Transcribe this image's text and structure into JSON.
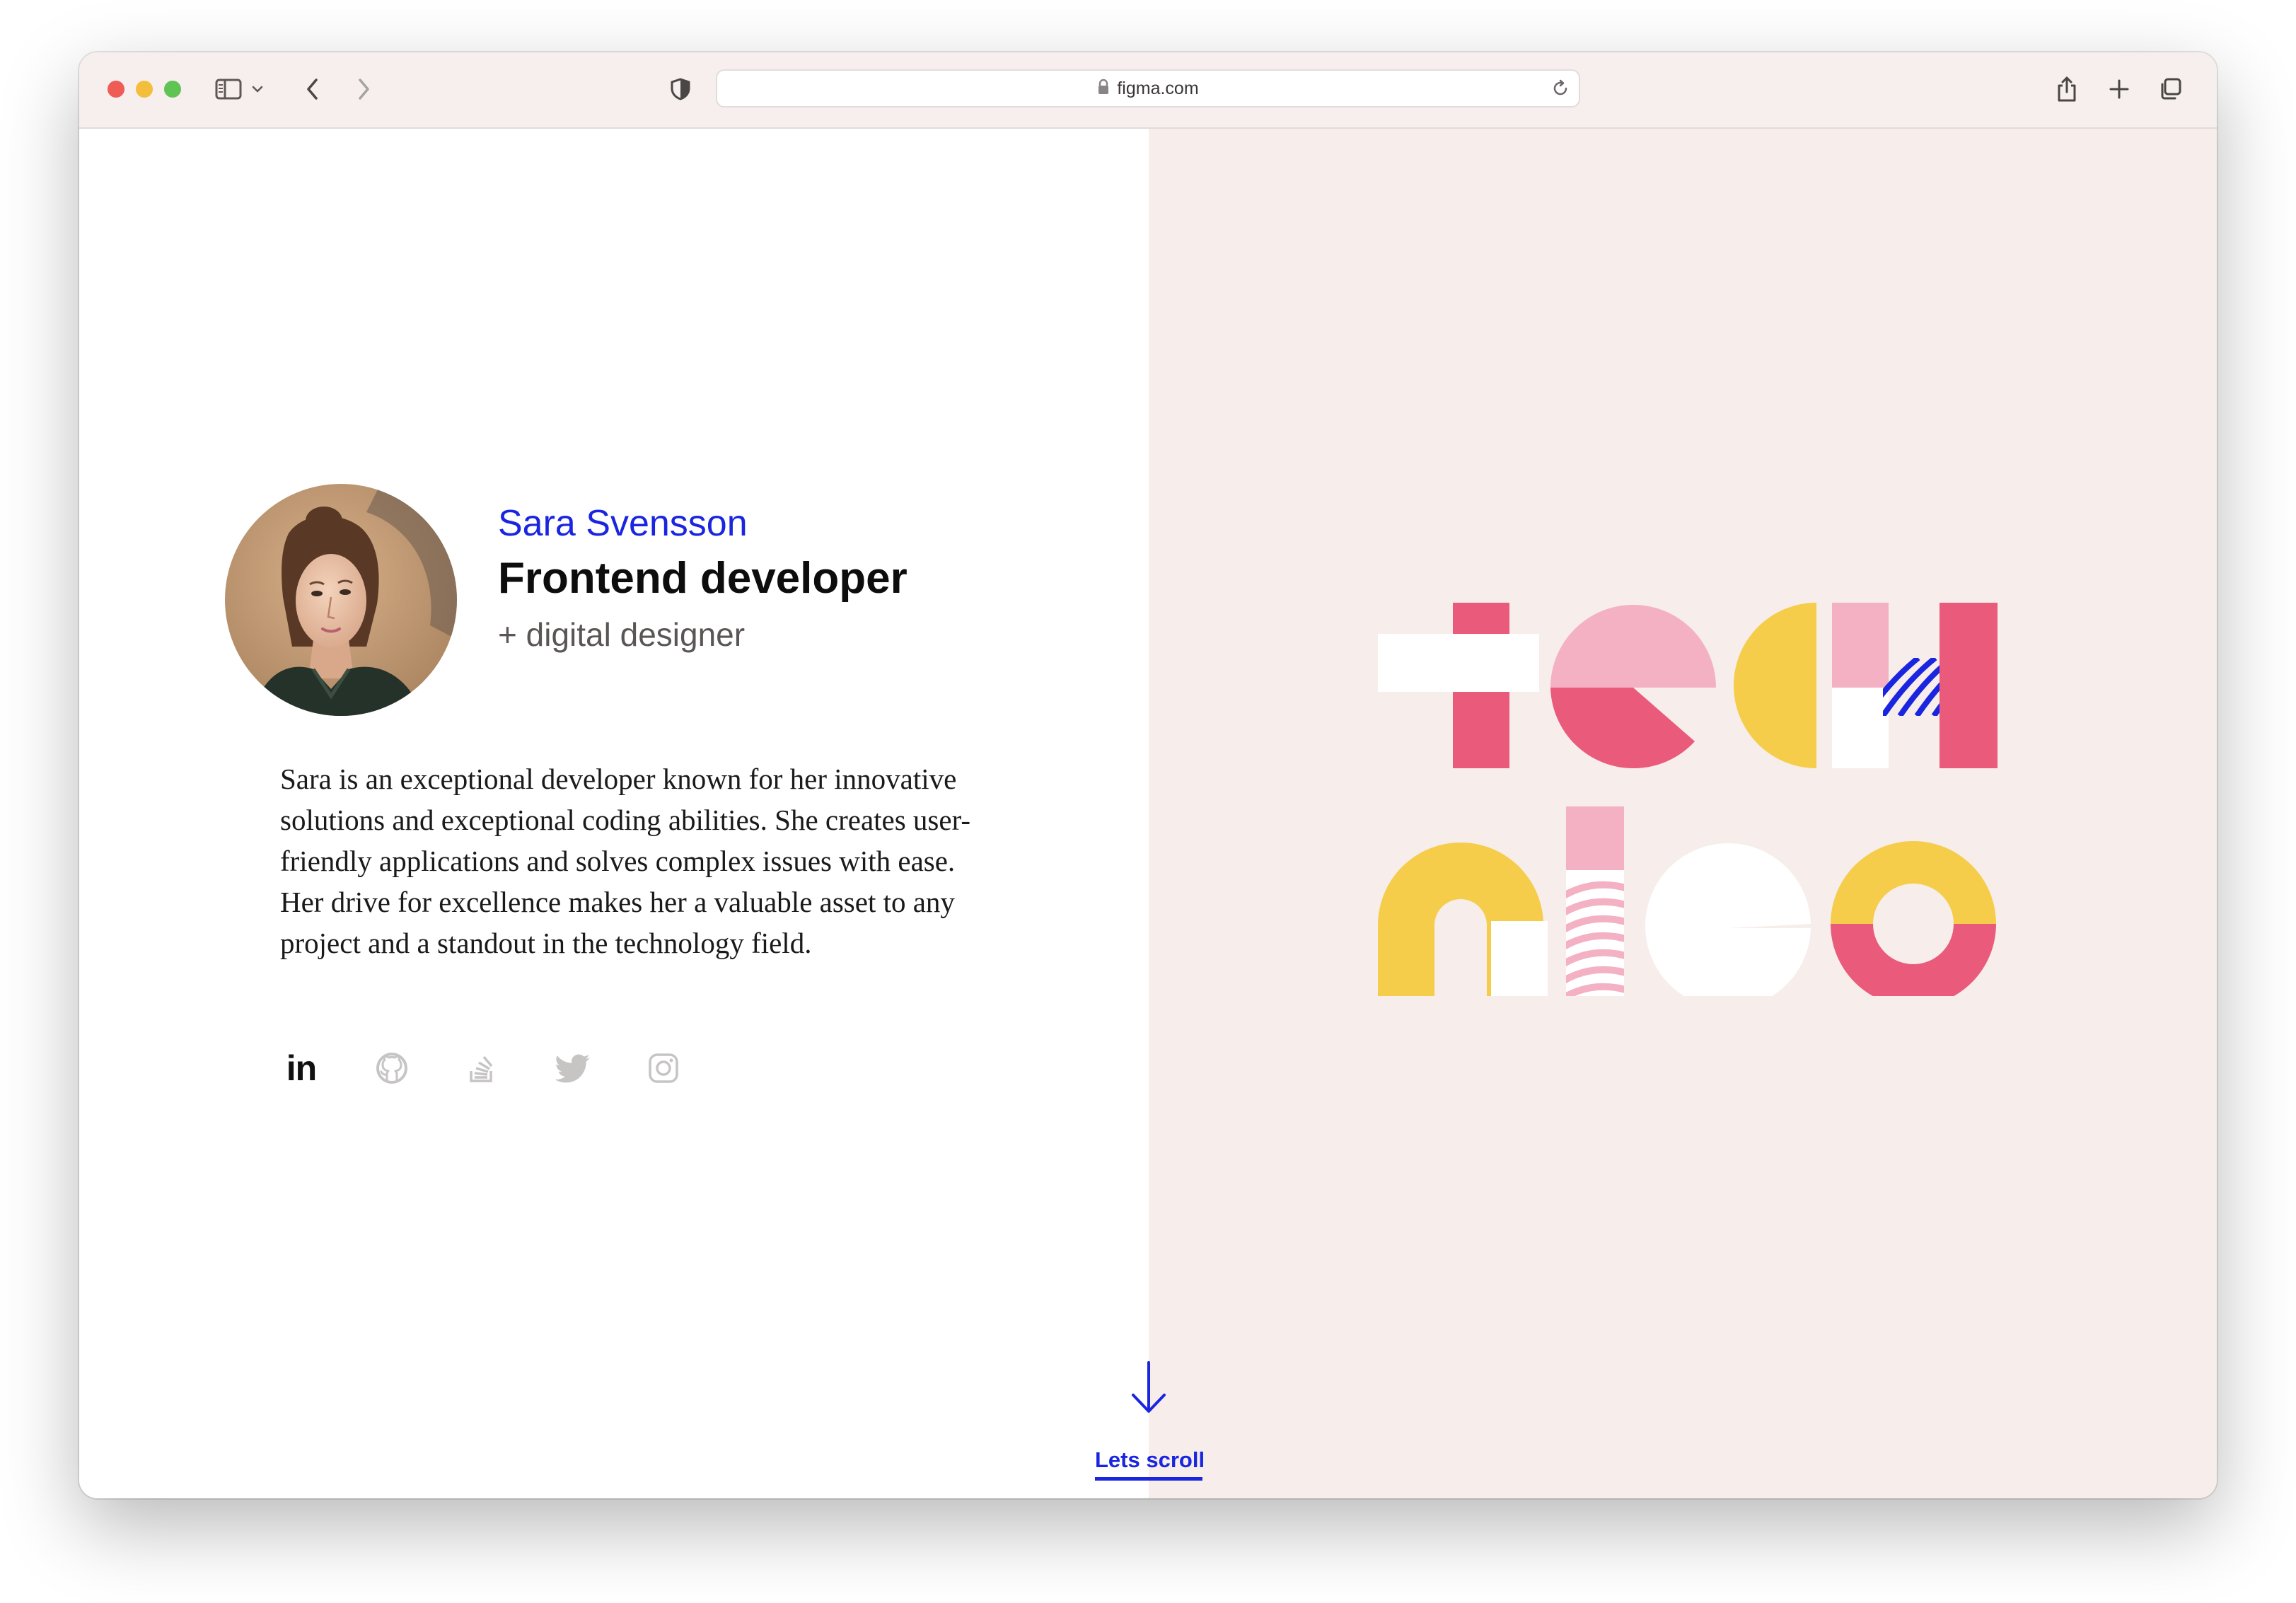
{
  "browser": {
    "url": "figma.com",
    "icons": {
      "sidebar": "sidebar-icon",
      "chevron": "chevron-down-icon",
      "back": "back-arrow-icon",
      "forward": "forward-arrow-icon",
      "privacy": "shield-icon",
      "lock": "lock-icon",
      "reload": "reload-icon",
      "share": "share-icon",
      "new_tab": "plus-icon",
      "tabs": "tabs-overview-icon"
    }
  },
  "profile": {
    "name": "Sara Svensson",
    "role": "Frontend developer",
    "sub": "+ digital designer",
    "bio": [
      "Sara is an exceptional developer known for her innovative",
      "solutions and exceptional coding abilities. She creates user-",
      "friendly applications and solves complex issues with ease.",
      "Her drive for excellence makes her a valuable asset to any",
      "project and a standout in the technology field."
    ]
  },
  "social": {
    "linkedin_label": "in",
    "items": [
      "linkedin-icon",
      "github-icon",
      "stackoverflow-icon",
      "twitter-icon",
      "instagram-icon"
    ],
    "active": "linkedin-icon"
  },
  "scroll": {
    "label": "Lets scroll",
    "icon": "arrow-down-icon"
  },
  "colors": {
    "accent_blue": "#1a25e0",
    "right_panel_bg": "#f7edea",
    "pink_dark": "#ea5a7a",
    "pink_light": "#f3b1c3",
    "yellow": "#f5cd4a",
    "white": "#ffffff"
  }
}
